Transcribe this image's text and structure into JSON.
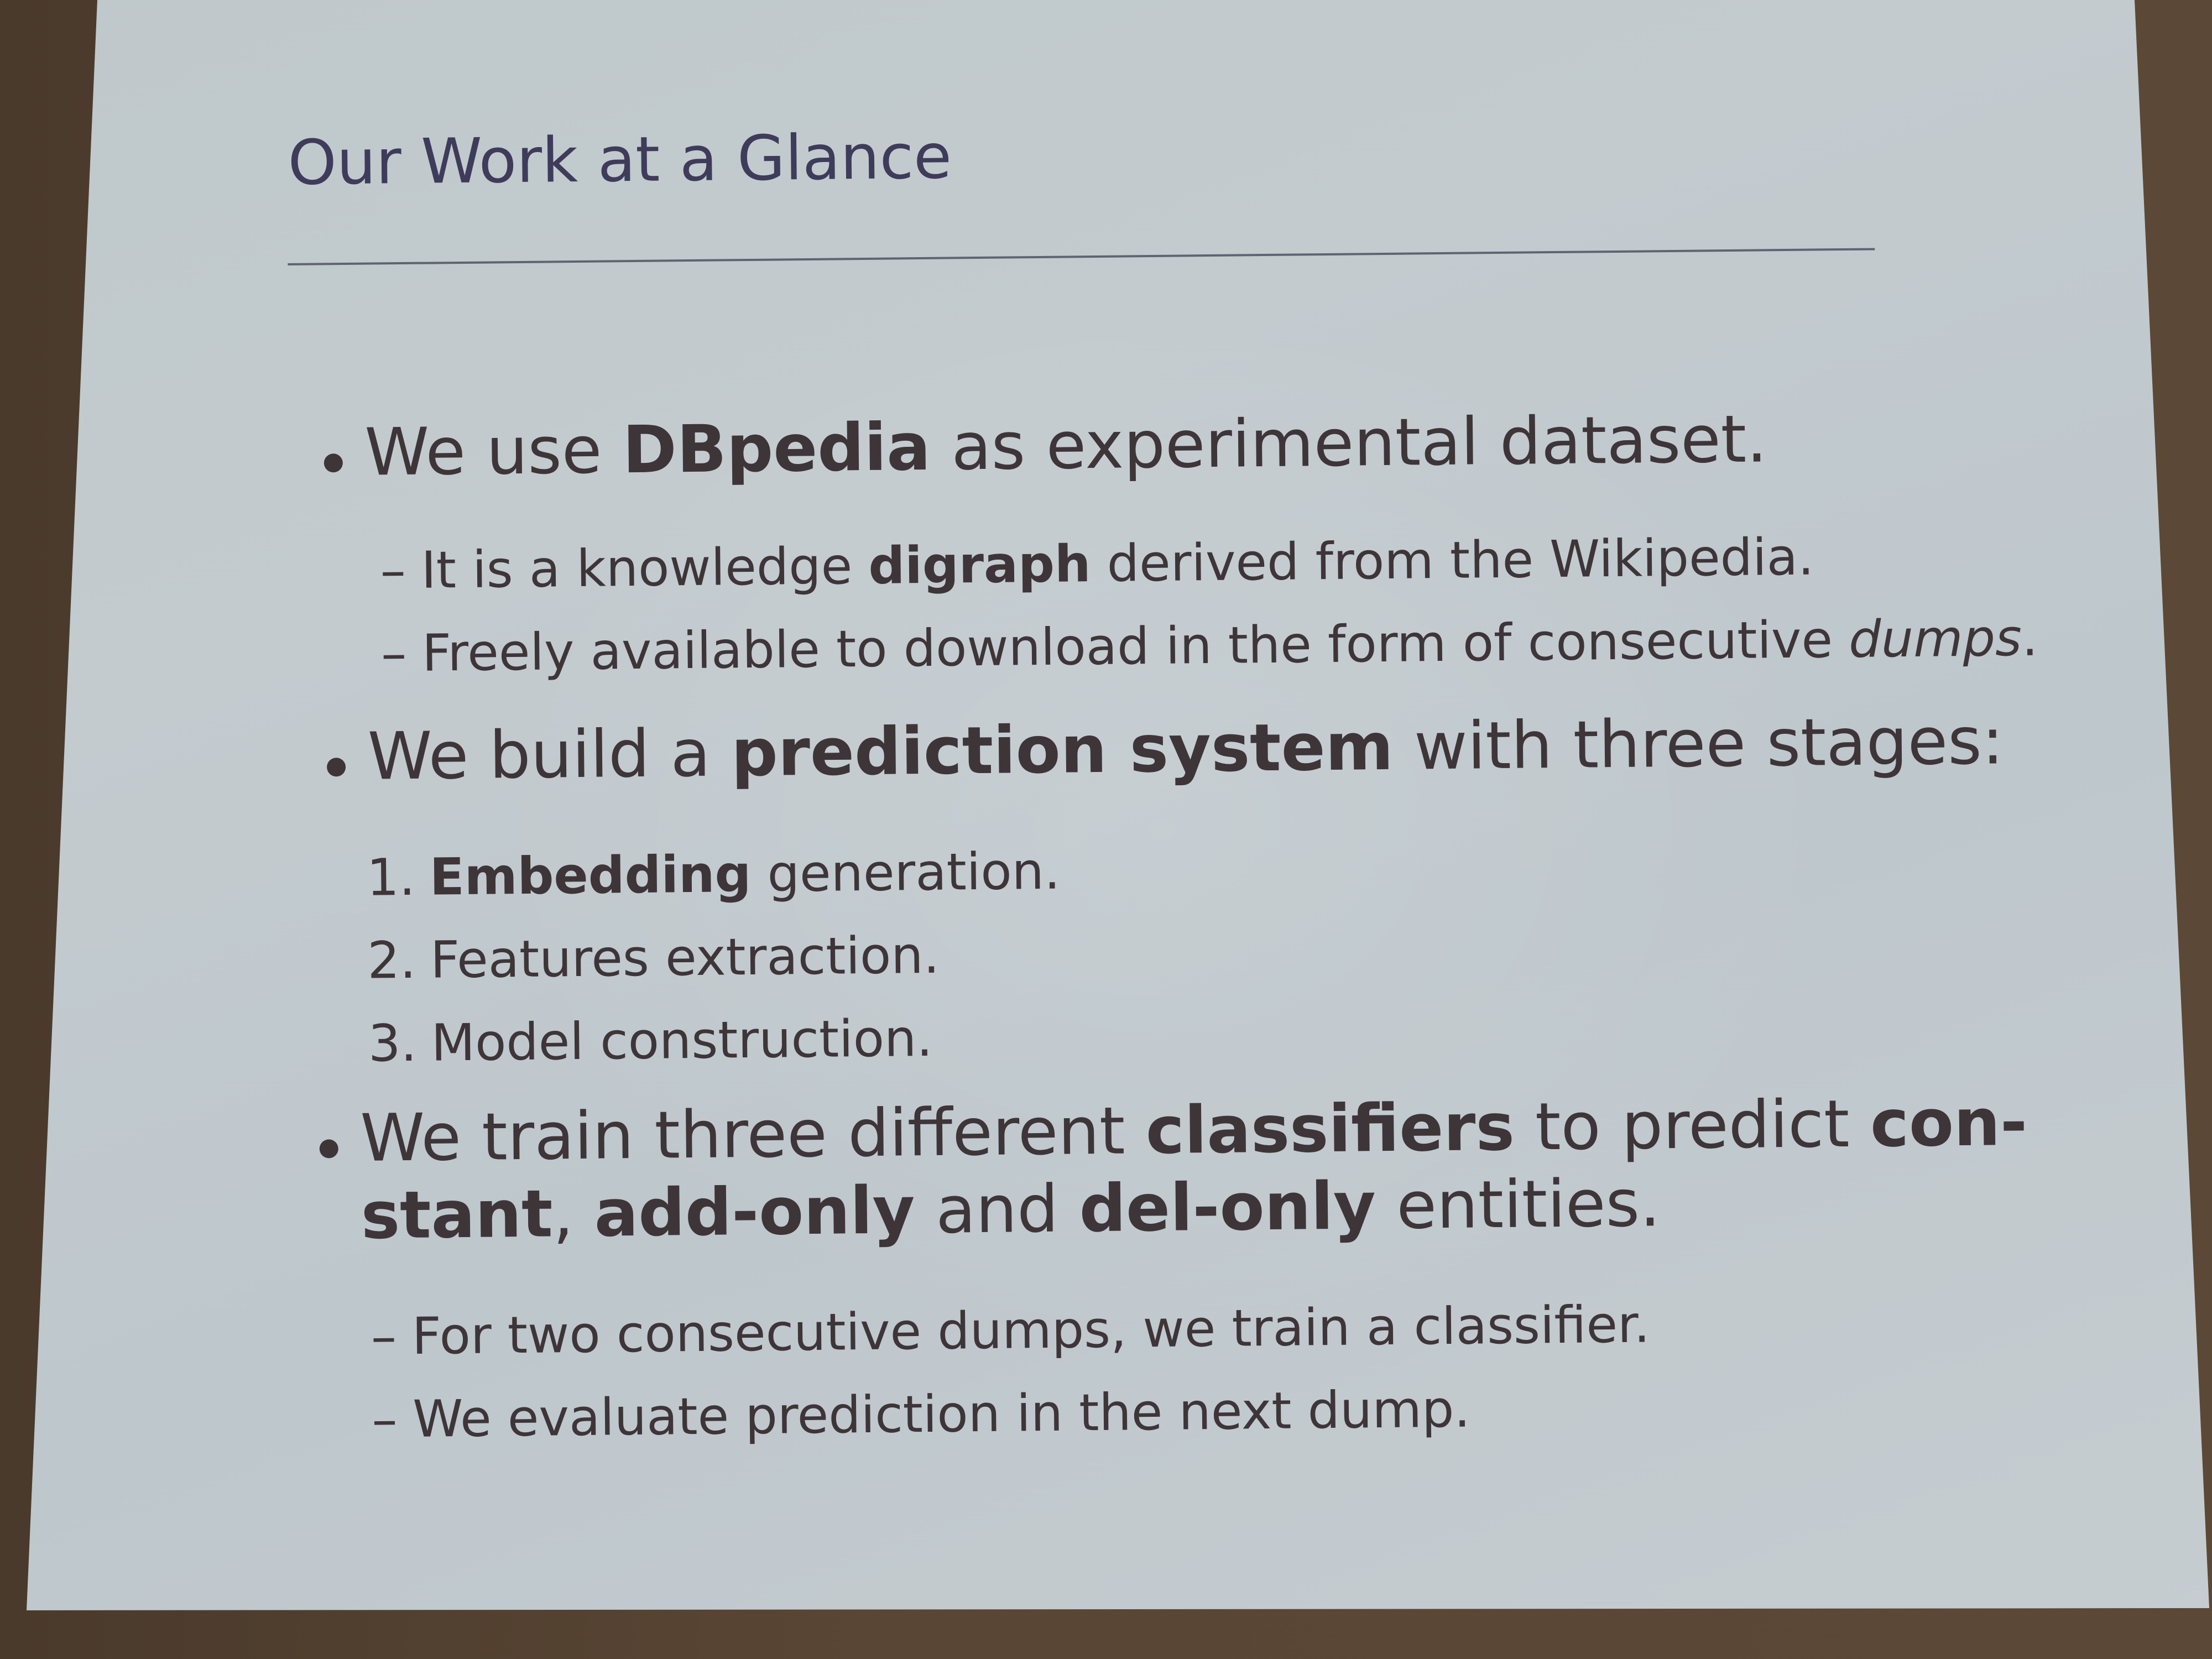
{
  "slide": {
    "title": "Our Work at a Glance",
    "b1": {
      "pre": "We use ",
      "bold": "DBpedia",
      "post": " as experimental dataset.",
      "sub1": {
        "dash": "–",
        "pre": "It is a knowledge ",
        "bold": "digraph",
        "post": " derived from the Wikipedia."
      },
      "sub2": {
        "dash": "–",
        "pre": "Freely available to download in the form of consecutive ",
        "italic": "dumps",
        "post": "."
      }
    },
    "b2": {
      "pre": "We build a ",
      "bold": "prediction system",
      "post": " with three stages:",
      "item1": {
        "num": "1.",
        "bold": "Embedding",
        "post": " generation."
      },
      "item2": {
        "num": "2.",
        "text": "Features extraction."
      },
      "item3": {
        "num": "3.",
        "text": "Model construction."
      }
    },
    "b3": {
      "line1_pre": "We train three different ",
      "line1_bold1": "classifiers",
      "line1_mid": " to predict ",
      "line1_bold2": "con-",
      "line2_bold1": "stant",
      "line2_sep": ", ",
      "line2_bold2": "add-only",
      "line2_mid": " and ",
      "line2_bold3": "del-only",
      "line2_post": " entities.",
      "sub1": {
        "dash": "–",
        "text": "For two consecutive dumps, we train a classifier."
      },
      "sub2": {
        "dash": "–",
        "text": "We evaluate prediction in the next dump."
      }
    }
  }
}
